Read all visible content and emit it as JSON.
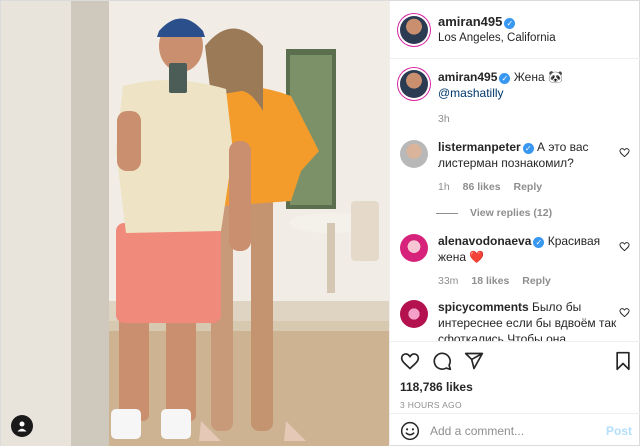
{
  "header": {
    "username": "amiran495",
    "location": "Los Angeles, California"
  },
  "caption": {
    "username": "amiran495",
    "text": "Жена 🐼",
    "mention": "@mashatilly",
    "time": "3h"
  },
  "comments": [
    {
      "username": "listermanpeter",
      "text": "А это вас листерман познакомил?",
      "time": "1h",
      "likes": "86 likes",
      "reply": "Reply",
      "verified": true
    },
    {
      "username": "alenavodonaeva",
      "text": "Красивая жена ❤️",
      "time": "33m",
      "likes": "18 likes",
      "reply": "Reply",
      "verified": true
    },
    {
      "username": "spicycomments",
      "text": "Было бы интереснее если бы вдвоём так сфоткались Чтобы она мизинцем закрывала твой...",
      "verified": false
    }
  ],
  "view_replies": "View replies (12)",
  "actions": {
    "likes": "118,786 likes",
    "time_ago": "3 HOURS AGO"
  },
  "add_comment": {
    "placeholder": "Add a comment...",
    "post_label": "Post"
  },
  "colors": {
    "verified": "#3897f0",
    "post_button": "#b2dffc",
    "meta_text": "#8e8e8e"
  },
  "icons": [
    "user-tag-icon",
    "verified-icon",
    "heart-icon",
    "comment-icon",
    "share-icon",
    "bookmark-icon",
    "emoji-icon"
  ]
}
